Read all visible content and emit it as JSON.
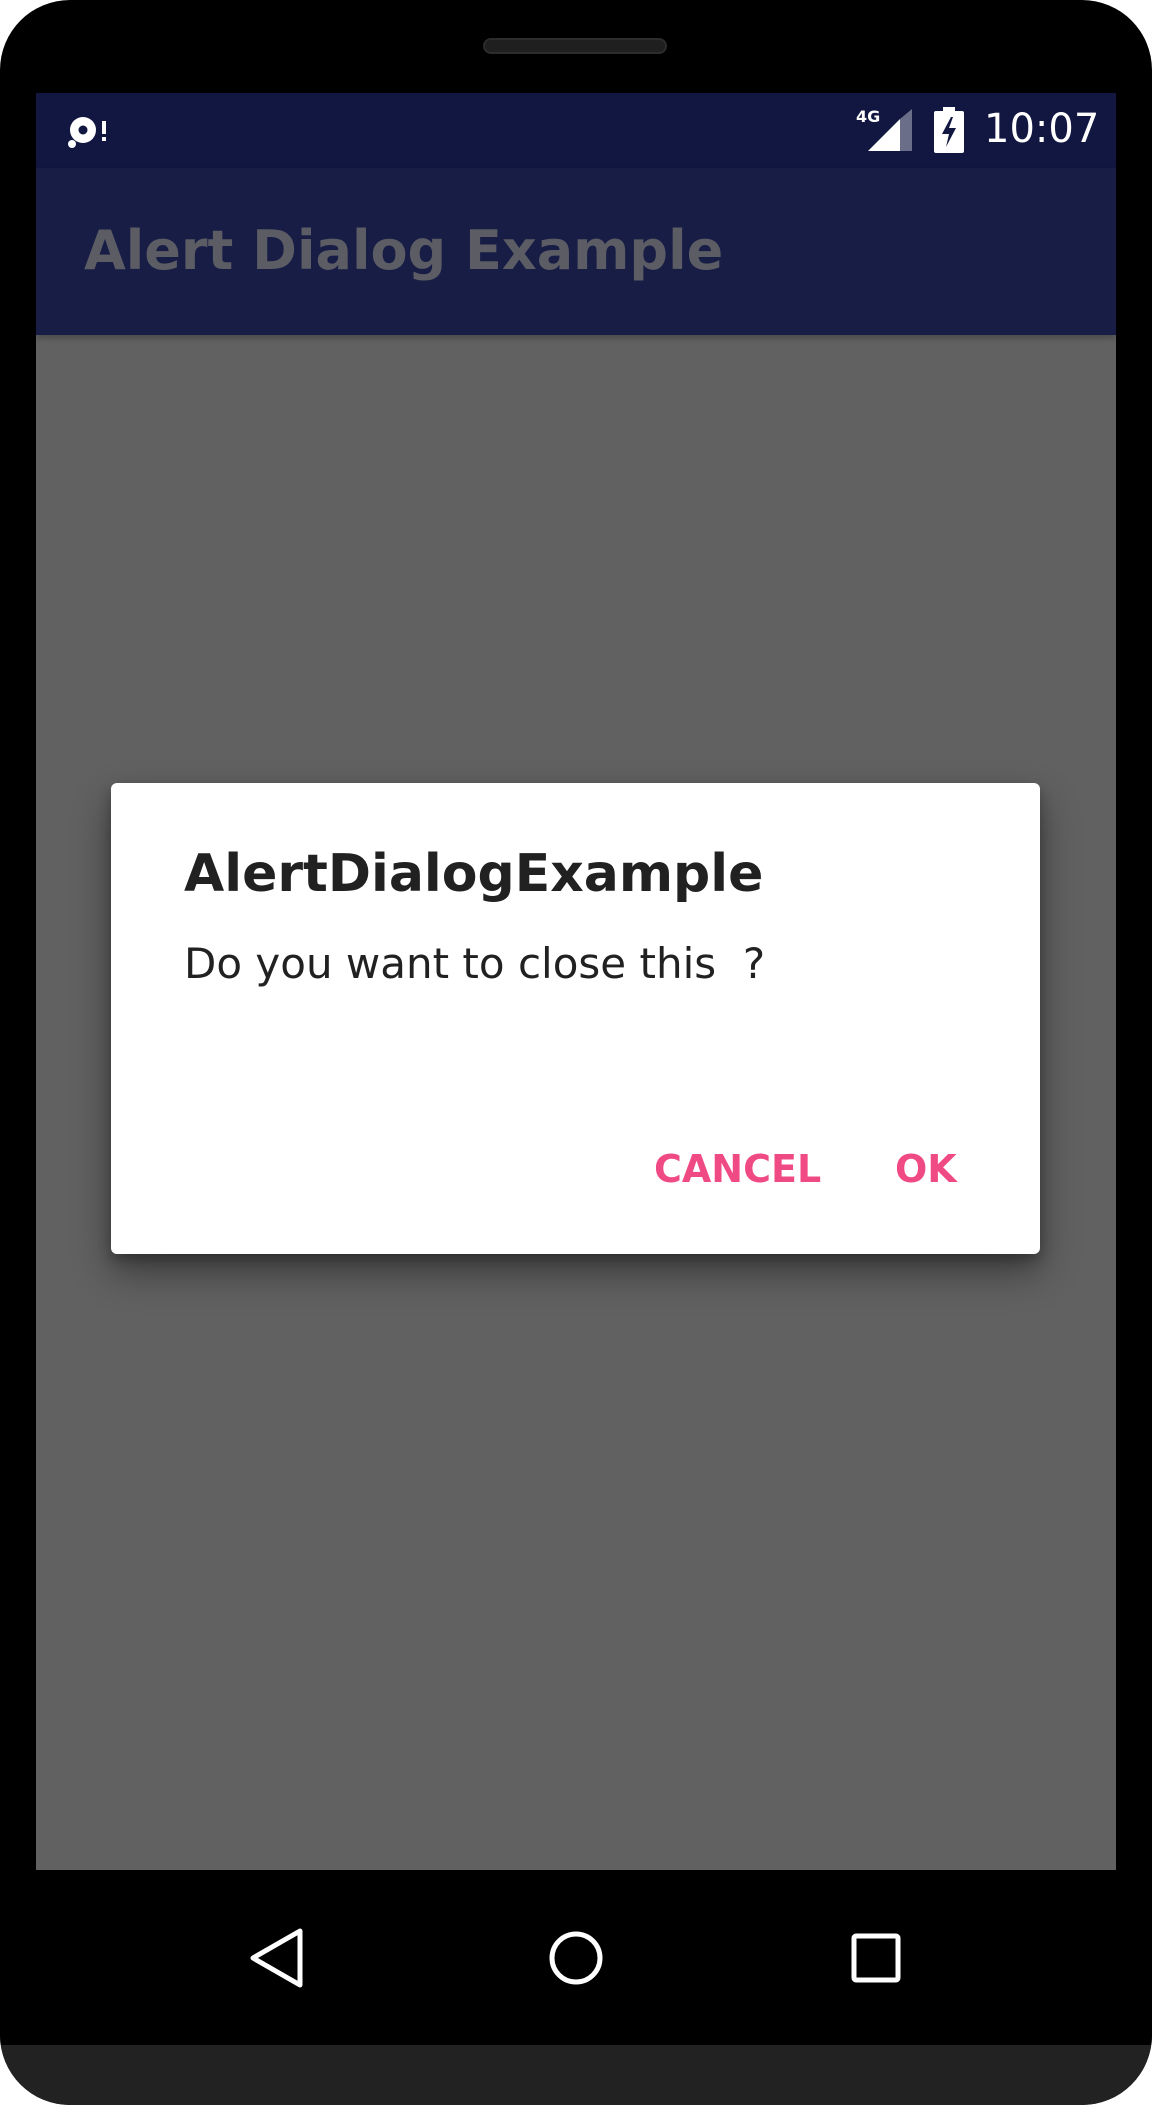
{
  "status_bar": {
    "left_icon": "sd-card-alert-icon",
    "network_type": "4G",
    "signal_icon": "cellular-signal-icon",
    "battery_icon": "battery-charging-icon",
    "time": "10:07"
  },
  "app_bar": {
    "title": "Alert Dialog Example"
  },
  "dialog": {
    "title": "AlertDialogExample",
    "message": "Do you want to close this  ?",
    "buttons": {
      "cancel": "CANCEL",
      "ok": "OK"
    }
  },
  "nav_bar": {
    "back_icon": "back-triangle-icon",
    "home_icon": "home-circle-icon",
    "recent_icon": "recent-apps-square-icon"
  },
  "colors": {
    "status_bar": "#121741",
    "app_bar": "#181d46",
    "scrim": "#616161",
    "accent": "#f04a85",
    "dialog_text": "#212121"
  }
}
